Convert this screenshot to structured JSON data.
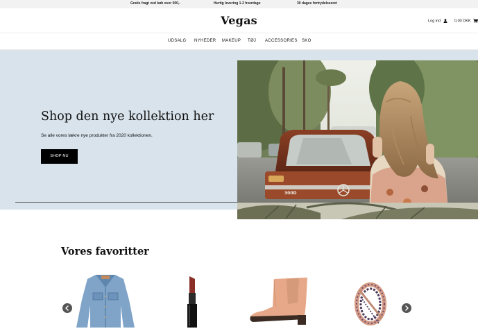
{
  "topbar": {
    "item1": "Gratis fragt ved køb over 500,-",
    "item2": "Hurtig levering 1-2 hverdage",
    "item3": "30 dages fortrydelsesret"
  },
  "header": {
    "logo": "Vegas",
    "login_label": "Log ind",
    "cart_label": "0,00 DKK"
  },
  "nav": {
    "items": [
      "UDSALG",
      "NYHEDER",
      "MAKEUP",
      "TØJ",
      "ACCESSORIES",
      "SKO"
    ]
  },
  "hero": {
    "title": "Shop den nye kollektion her",
    "subtitle": "Se alle vores lækre nye produkter fra 2020 kollektionen.",
    "button": "SHOP NU",
    "car_plate": "300D"
  },
  "favorites": {
    "title": "Vores favoritter",
    "products": [
      "denim-jacket",
      "lipstick",
      "ankle-boot",
      "ring"
    ]
  },
  "colors": {
    "hero_bg": "#d8e3ec",
    "button_bg": "#000000",
    "arrow_bg": "#555555"
  }
}
